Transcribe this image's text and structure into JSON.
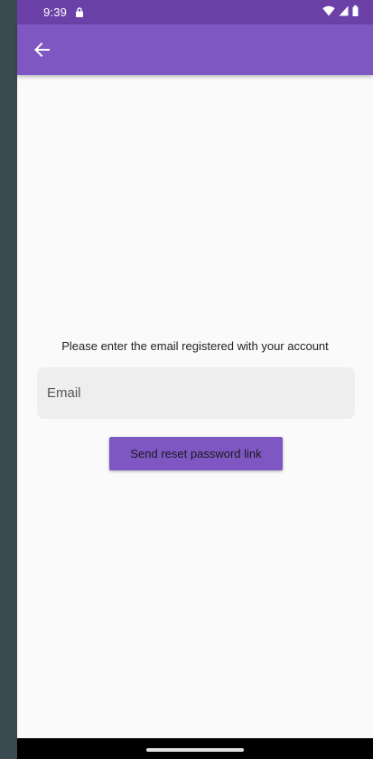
{
  "status_bar": {
    "time": "9:39",
    "icons": [
      "lock-icon",
      "wifi-icon",
      "signal-icon",
      "battery-icon"
    ]
  },
  "app_bar": {
    "back_icon": "arrow-back-icon",
    "color": "#7e57c2"
  },
  "form": {
    "instruction": "Please enter the email registered with your account",
    "email_placeholder": "Email",
    "email_value": "",
    "send_button_label": "Send reset password link"
  },
  "colors": {
    "primary": "#7e57c2",
    "status_bar": "#6b41a8",
    "background": "#fafafa",
    "field_background": "#eeeeee"
  }
}
